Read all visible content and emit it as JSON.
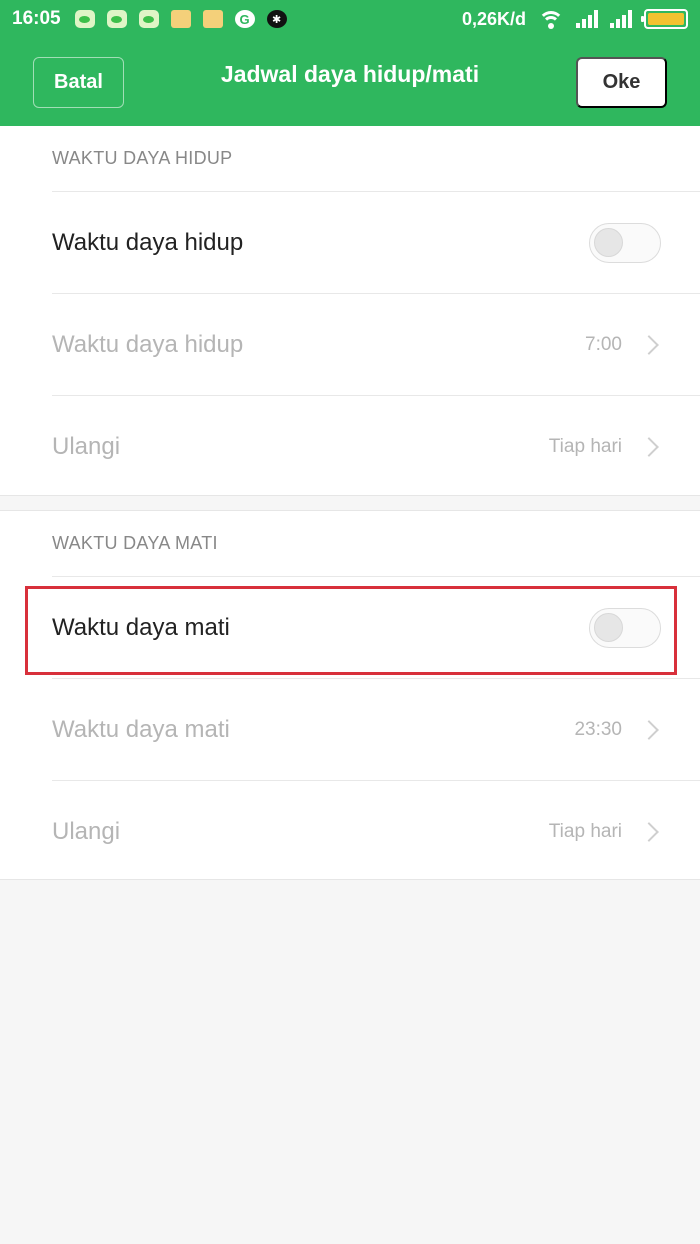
{
  "status_bar": {
    "time": "16:05",
    "net_speed": "0,26K/d",
    "notification_icons": [
      "line-icon",
      "line-icon",
      "line-icon",
      "message-icon",
      "message-icon",
      "google-icon",
      "bug-icon"
    ],
    "google_glyph": "G",
    "battery_color": "#f2c230"
  },
  "header": {
    "cancel_label": "Batal",
    "title": "Jadwal daya hidup/mati",
    "ok_label": "Oke",
    "color": "#2fb75e"
  },
  "power_on": {
    "section_title": "WAKTU DAYA HIDUP",
    "toggle_label": "Waktu daya hidup",
    "toggle_on": false,
    "time_label": "Waktu daya hidup",
    "time_value": "7:00",
    "repeat_label": "Ulangi",
    "repeat_value": "Tiap hari"
  },
  "power_off": {
    "section_title": "WAKTU DAYA MATI",
    "toggle_label": "Waktu daya mati",
    "toggle_on": false,
    "time_label": "Waktu daya mati",
    "time_value": "23:30",
    "repeat_label": "Ulangi",
    "repeat_value": "Tiap hari"
  },
  "highlight_color": "#d8303b"
}
